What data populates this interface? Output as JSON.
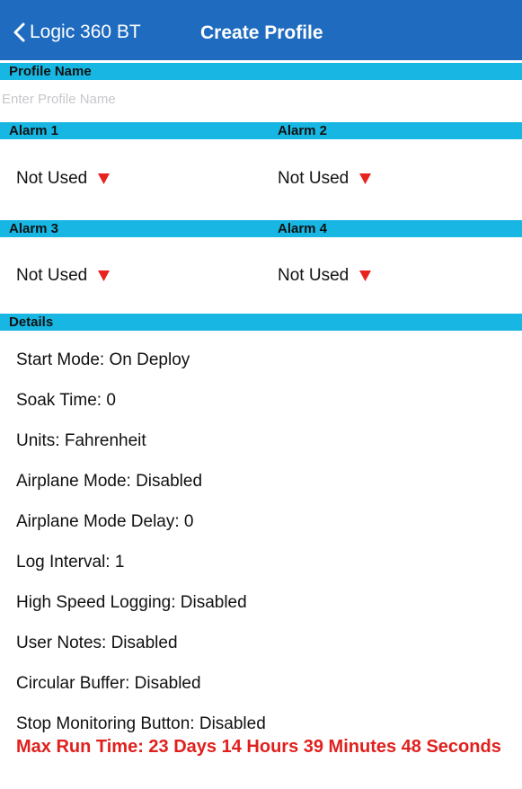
{
  "navbar": {
    "back_label": "Logic 360 BT",
    "title": "Create Profile"
  },
  "profile_name": {
    "header": "Profile Name",
    "placeholder": "Enter Profile Name",
    "value": ""
  },
  "alarms": {
    "alarm1": {
      "header": "Alarm 1",
      "value": "Not Used"
    },
    "alarm2": {
      "header": "Alarm 2",
      "value": "Not Used"
    },
    "alarm3": {
      "header": "Alarm 3",
      "value": "Not Used"
    },
    "alarm4": {
      "header": "Alarm 4",
      "value": "Not Used"
    }
  },
  "details": {
    "header": "Details",
    "items": [
      "Start Mode: On Deploy",
      "Soak Time: 0",
      "Units: Fahrenheit",
      "Airplane Mode: Disabled",
      "Airplane Mode Delay: 0",
      "Log Interval: 1",
      "High Speed Logging: Disabled",
      "User Notes: Disabled",
      "Circular Buffer: Disabled",
      "Stop Monitoring Button: Disabled"
    ],
    "max_run_time": "Max Run Time: 23 Days 14 Hours 39 Minutes 48 Seconds"
  },
  "colors": {
    "navbar": "#1f6bbf",
    "section_header": "#17b6e3",
    "dropdown_arrow": "#e8231f",
    "warning_text": "#e0201d"
  },
  "icons": {
    "back": "chevron-left-icon",
    "dropdown": "triangle-down-icon"
  }
}
